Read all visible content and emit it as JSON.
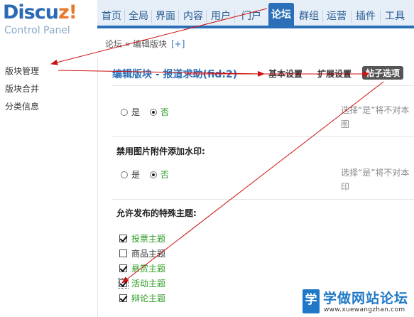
{
  "logo": {
    "main_prefix": "Discu",
    "main_accent": "z!",
    "sub": "Control Panel"
  },
  "nav": {
    "items": [
      "首页",
      "全局",
      "界面",
      "内容",
      "用户",
      "门户",
      "论坛",
      "群组",
      "运营",
      "插件",
      "工具"
    ],
    "active": "论坛"
  },
  "breadcrumb": {
    "text": "论坛 » 编辑版块",
    "plus": "[+]"
  },
  "sidebar": {
    "items": [
      "版块管理",
      "版块合并",
      "分类信息"
    ],
    "active": "版块管理"
  },
  "content": {
    "title": "编辑版块 - 报道求助(fid:2)",
    "tabs": [
      "基本设置",
      "扩展设置",
      "帖子选项"
    ],
    "active_tab": "帖子选项",
    "section1": {
      "yes": "是",
      "no": "否",
      "selected": "否",
      "hint_line1": "选择“是”将不对本",
      "hint_line2": "图"
    },
    "section2": {
      "label": "禁用图片附件添加水印:",
      "yes": "是",
      "no": "否",
      "selected": "否",
      "hint_line1": "选择“是”将不对本",
      "hint_line2": "印"
    },
    "section3": {
      "label": "允许发布的特殊主题:",
      "options": [
        {
          "label": "投票主题",
          "checked": true
        },
        {
          "label": "商品主题",
          "checked": false
        },
        {
          "label": "悬赏主题",
          "checked": true
        },
        {
          "label": "活动主题",
          "checked": true
        },
        {
          "label": "辩论主题",
          "checked": true
        }
      ]
    }
  },
  "watermark": {
    "icon": "学",
    "title": "学做网站论坛",
    "url": "www.xuewangzhan.com"
  },
  "colors": {
    "accent": "#2a6fb8",
    "checked_text": "#2a9a20",
    "arrow": "#cc1111"
  }
}
